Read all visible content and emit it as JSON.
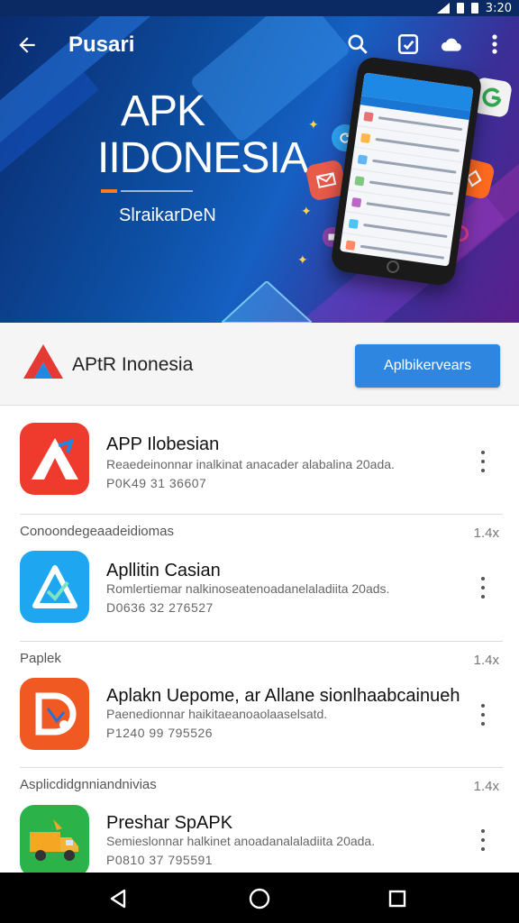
{
  "status_bar": {
    "time": "3:20"
  },
  "toolbar": {
    "title": "Pusari",
    "icons": [
      "back-arrow-icon",
      "search-icon",
      "share-icon",
      "cloud-icon",
      "more-vert-icon"
    ]
  },
  "hero": {
    "title_line1": "APK",
    "title_line2": "IIDONESIA",
    "subtitle": "SlraikarDeN"
  },
  "app_header": {
    "name": "APtR Inonesia",
    "button_label": "Aplbikervears"
  },
  "list": {
    "items": [
      {
        "section_label": "",
        "section_meta": "",
        "title": "APP Ilobesian",
        "description": "Reaedeinonnar inalkinat anacader alabalina 20ada.",
        "meta": "P0K49 31 36607",
        "icon_color": "#ef3b2d"
      },
      {
        "section_label": "Conoondegeaadeidiomas",
        "section_meta": "1.4x",
        "title": "Apllitin Casian",
        "description": "Romlertiemar nalkinoseatenoadanelaladiita 20ads.",
        "meta": "D0636 32 276527",
        "icon_color": "#1ea7f0"
      },
      {
        "section_label": "Paplek",
        "section_meta": "1.4x",
        "title": "Aplakn Uepome, ar Allane sionlhaabcainueh",
        "description": "Paenedionnar haikitaeanoaolaaselsatd.",
        "meta": "P1240 99 795526",
        "icon_color": "#f05a22"
      },
      {
        "section_label": "Asplicdidgnniandnivias",
        "section_meta": "1.4x",
        "title": "Preshar SpAPK",
        "description": "Semieslonnar halkinet anoadanalaladiita 20ada.",
        "meta": "P0810 37 795591",
        "icon_color": "#2bb34a"
      }
    ]
  },
  "nav_bar": {
    "icons": [
      "back-triangle-icon",
      "home-circle-icon",
      "recents-square-icon"
    ]
  },
  "colors": {
    "accent": "#2f86e0",
    "status_bar": "#0b2a63",
    "hero_start": "#0a2b6e",
    "hero_end": "#5a1f8c"
  }
}
